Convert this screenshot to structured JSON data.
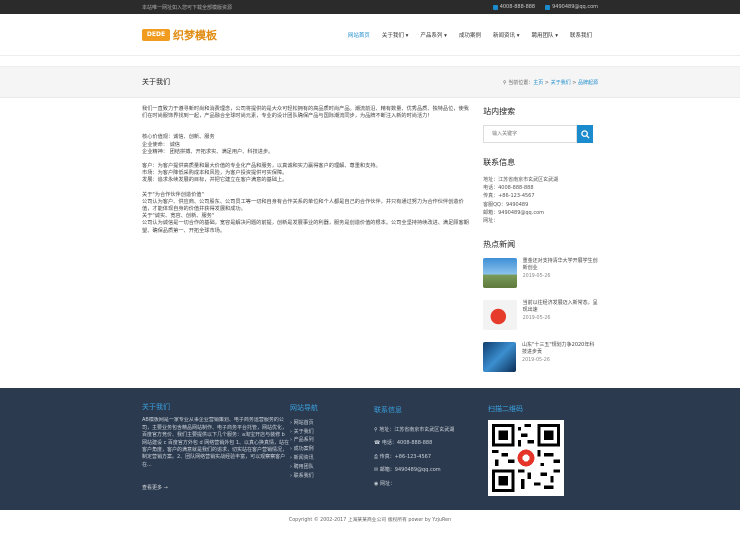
{
  "topbar": {
    "notice": "本站唯一网址如入您可下载全部模版资源",
    "phone": "4008-888-888",
    "email": "9490489@qq.com"
  },
  "header": {
    "logo_mark": "DEDE",
    "logo_text": "织梦模板",
    "nav": [
      "网站首页",
      "关于我们 ▾",
      "产品系列 ▾",
      "成功案例",
      "新闻资讯 ▾",
      "聘用团队 ▾",
      "联系我们"
    ]
  },
  "banner": {
    "title": "关于我们",
    "breadcrumb_prefix": "当前位置：",
    "crumb1": "主页",
    "crumb2": "关于我们",
    "crumb3": "品牌起源"
  },
  "content": {
    "intro": "我们一直致力于遵寻新时尚和消费理念，公司将提供的是大众可轻松拥有的高品质时尚产品。潮流前沿、精有数量、优秀品质、独特品位，使我们在时尚服饰界找到一起，产品融合全球时尚元素，专业的设计团队确保产品与国际潮流同步，为品牌不断注入新的时尚活力！",
    "core_title": "核心价值观：诚信、创新、服务",
    "mission": "企业使命： 诚信",
    "spirit": "企业精神： 团结拼搏、开拓求实、满足用户、科技进步。",
    "c1": "客户：为客户提供高质量和最大价值的专业化产品和服务，以真诚和实力赢得客户的理解、尊重和支持。",
    "c2": "市场：为客户降低采购成本和风险，为客户投资提供可实保障。",
    "c3": "发展：追求永续发展的目标，并把它建立在客户满意的基础上。",
    "c4": "关于\"为合作伙伴创造价值\"",
    "c5": "公司认为客户、供应商、公司股东、公司员工等一切和自身有合作关系的单位和个人都是自己的合作伙伴，并只有通过努力为合作伙伴创造价值，才能体现自身的价值并获得发展和成功。",
    "c6": "关于\"诚实、宽容、创新、服务\"",
    "c7": "公司认为诚信是一切合作的基础，宽容是解决问题的前提，创新是发展事业的利器，服务是创造价值的根本。公司全坚持持续改进、满足顾客期望、确保品质第一、开拓全球市场。"
  },
  "side": {
    "search_title": "站内搜索",
    "search_placeholder": "输入关键字",
    "contact_title": "联系信息",
    "address": "地址：江苏省南京市玄武区玄武湖",
    "tel": "电话：4008-888-888",
    "fax": "传真：+86-123-4567",
    "qq": "客服QQ：9490489",
    "mail": "邮箱：9490489@qq.com",
    "web": "网址：",
    "hot_title": "热点新闻",
    "news": [
      {
        "title": "重金还对支持清华大学开展学生创新创业",
        "date": "2019-05-26"
      },
      {
        "title": "当前以往经济发展迈入新常态，呈现出速",
        "date": "2019-05-26"
      },
      {
        "title": "山东\"十三五\"规划力争2020年科技进步贡",
        "date": "2019-05-26"
      }
    ]
  },
  "footer": {
    "about_title": "关于我们",
    "about_text": "AB模板网是一家专业从事企业营销策划、电子商务运营服务的公司，主要业务包含精品网站制作、电子商务平台托管，网站优化，百度官方竞价、我们主要提供以下几个服务：a淘宝开店与装修 b 网站建设 c 百度官方外包 d 网络营销外包 1、以真心换真情，站在客户角度，客户的满意就是我们的追求，切实站在客户营销情况，制定营销方案。2、团队网络营销实战经验丰富，可以观察察客户在...",
    "more": "查看更多 →",
    "nav_title": "网站导航",
    "nav": [
      "网站首页",
      "关于我们",
      "产品系列",
      "成功案例",
      "新闻资讯",
      "聘用团队",
      "联系我们"
    ],
    "contact_title": "联系信息",
    "address": "地址：江苏省南京市玄武区玄武湖",
    "tel": "电话：4008-888-888",
    "fax": "传真：+86-123-4567",
    "mail": "邮箱：9490489@qq.com",
    "web": "网址：",
    "qr_title": "扫描二维码"
  },
  "copyright": "Copyright © 2002-2017 上海某某商业公司 版权所有 power by YzjuRen",
  "colors": {
    "accent": "#1a8bcc",
    "footer_bg": "#2b3a4f",
    "logo": "#f29c1f"
  }
}
